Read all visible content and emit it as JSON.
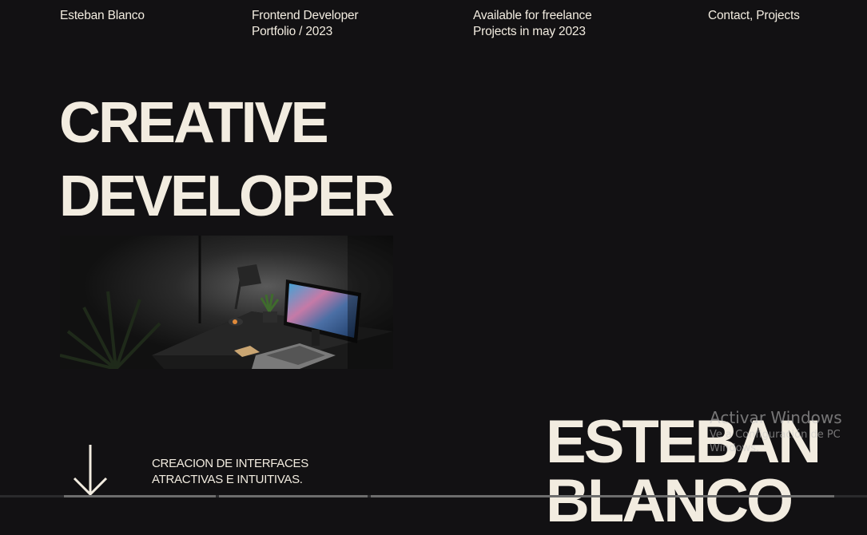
{
  "header": {
    "name": "Esteban Blanco",
    "role_line1": "Frontend Developer",
    "role_line2": "Portfolio / 2023",
    "availability_line1": "Available for freelance",
    "availability_line2": "Projects in may 2023",
    "links": "Contact, Projects"
  },
  "hero": {
    "line1": "CREATIVE",
    "line2": "DEVELOPER"
  },
  "tagline": {
    "line1": "CREACION DE INTERFACES",
    "line2": "ATRACTIVAS E INTUITIVAS."
  },
  "big_name": {
    "line1": "ESTEBAN",
    "line2": "BLANCO"
  },
  "windows_watermark": {
    "title": "Activar Windows",
    "line1": "Ve a Configuración de PC",
    "line2": "Windows."
  },
  "colors": {
    "background": "#121113",
    "text": "#f2ece0"
  },
  "icons": {
    "scroll": "arrow-down-icon"
  }
}
